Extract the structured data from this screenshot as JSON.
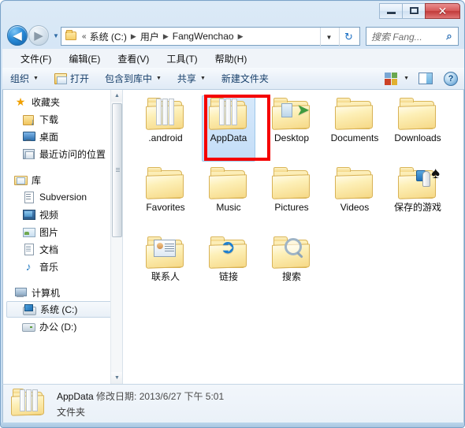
{
  "window": {
    "title": "",
    "buttons": {
      "minimize": "minimize-button",
      "maximize": "maximize-button",
      "close": "✕"
    }
  },
  "address_bar": {
    "back_glyph": "◀",
    "forward_glyph": "▶",
    "history_glyph": "▼",
    "overflow_chevrons": "«",
    "crumbs": [
      "系统 (C:)",
      "用户",
      "FangWenchao"
    ],
    "separator": "▶",
    "dropdown_glyph": "▼",
    "refresh_glyph": "↻"
  },
  "search": {
    "placeholder": "搜索 Fang...",
    "icon": "search-icon"
  },
  "menu": {
    "items": [
      "文件(F)",
      "编辑(E)",
      "查看(V)",
      "工具(T)",
      "帮助(H)"
    ]
  },
  "toolbar": {
    "organize": "组织",
    "open": "打开",
    "include_in_library": "包含到库中",
    "share": "共享",
    "new_folder": "新建文件夹",
    "caret": "▼",
    "help_glyph": "?"
  },
  "sidebar": {
    "groups": [
      {
        "header": {
          "label": "收藏夹",
          "icon": "star-icon"
        },
        "items": [
          {
            "label": "下载",
            "icon": "downloads-icon"
          },
          {
            "label": "桌面",
            "icon": "desktop-icon"
          },
          {
            "label": "最近访问的位置",
            "icon": "recent-places-icon"
          }
        ]
      },
      {
        "header": {
          "label": "库",
          "icon": "library-icon"
        },
        "items": [
          {
            "label": "Subversion",
            "icon": "document-icon"
          },
          {
            "label": "视频",
            "icon": "videos-icon"
          },
          {
            "label": "图片",
            "icon": "pictures-icon"
          },
          {
            "label": "文档",
            "icon": "documents-icon"
          },
          {
            "label": "音乐",
            "icon": "music-icon"
          }
        ]
      },
      {
        "header": {
          "label": "计算机",
          "icon": "computer-icon"
        },
        "items": [
          {
            "label": "系统 (C:)",
            "icon": "system-drive-icon",
            "selected": true
          },
          {
            "label": "办公 (D:)",
            "icon": "drive-icon"
          }
        ]
      }
    ],
    "scroll_up_glyph": "▲",
    "scroll_down_glyph": "▼"
  },
  "files": [
    {
      "name": ".android",
      "icon": "folder-open-icon",
      "selected": false
    },
    {
      "name": "AppData",
      "icon": "folder-open-icon",
      "selected": true
    },
    {
      "name": "Desktop",
      "icon": "folder-desktop-icon",
      "selected": false
    },
    {
      "name": "Documents",
      "icon": "folder-icon",
      "selected": false
    },
    {
      "name": "Downloads",
      "icon": "folder-icon",
      "selected": false
    },
    {
      "name": "Favorites",
      "icon": "folder-icon",
      "selected": false
    },
    {
      "name": "Music",
      "icon": "folder-icon",
      "selected": false
    },
    {
      "name": "Pictures",
      "icon": "folder-icon",
      "selected": false
    },
    {
      "name": "Videos",
      "icon": "folder-icon",
      "selected": false
    },
    {
      "name": "保存的游戏",
      "icon": "folder-games-icon",
      "selected": false
    },
    {
      "name": "联系人",
      "icon": "folder-contacts-icon",
      "selected": false
    },
    {
      "name": "链接",
      "icon": "folder-links-icon",
      "selected": false
    },
    {
      "name": "搜索",
      "icon": "folder-search-icon",
      "selected": false
    }
  ],
  "details_pane": {
    "name": "AppData",
    "modified_label": "修改日期:",
    "modified_value": "2013/6/27 下午 5:01",
    "type": "文件夹"
  },
  "annotation": {
    "color": "#f50000",
    "target": "AppData"
  }
}
